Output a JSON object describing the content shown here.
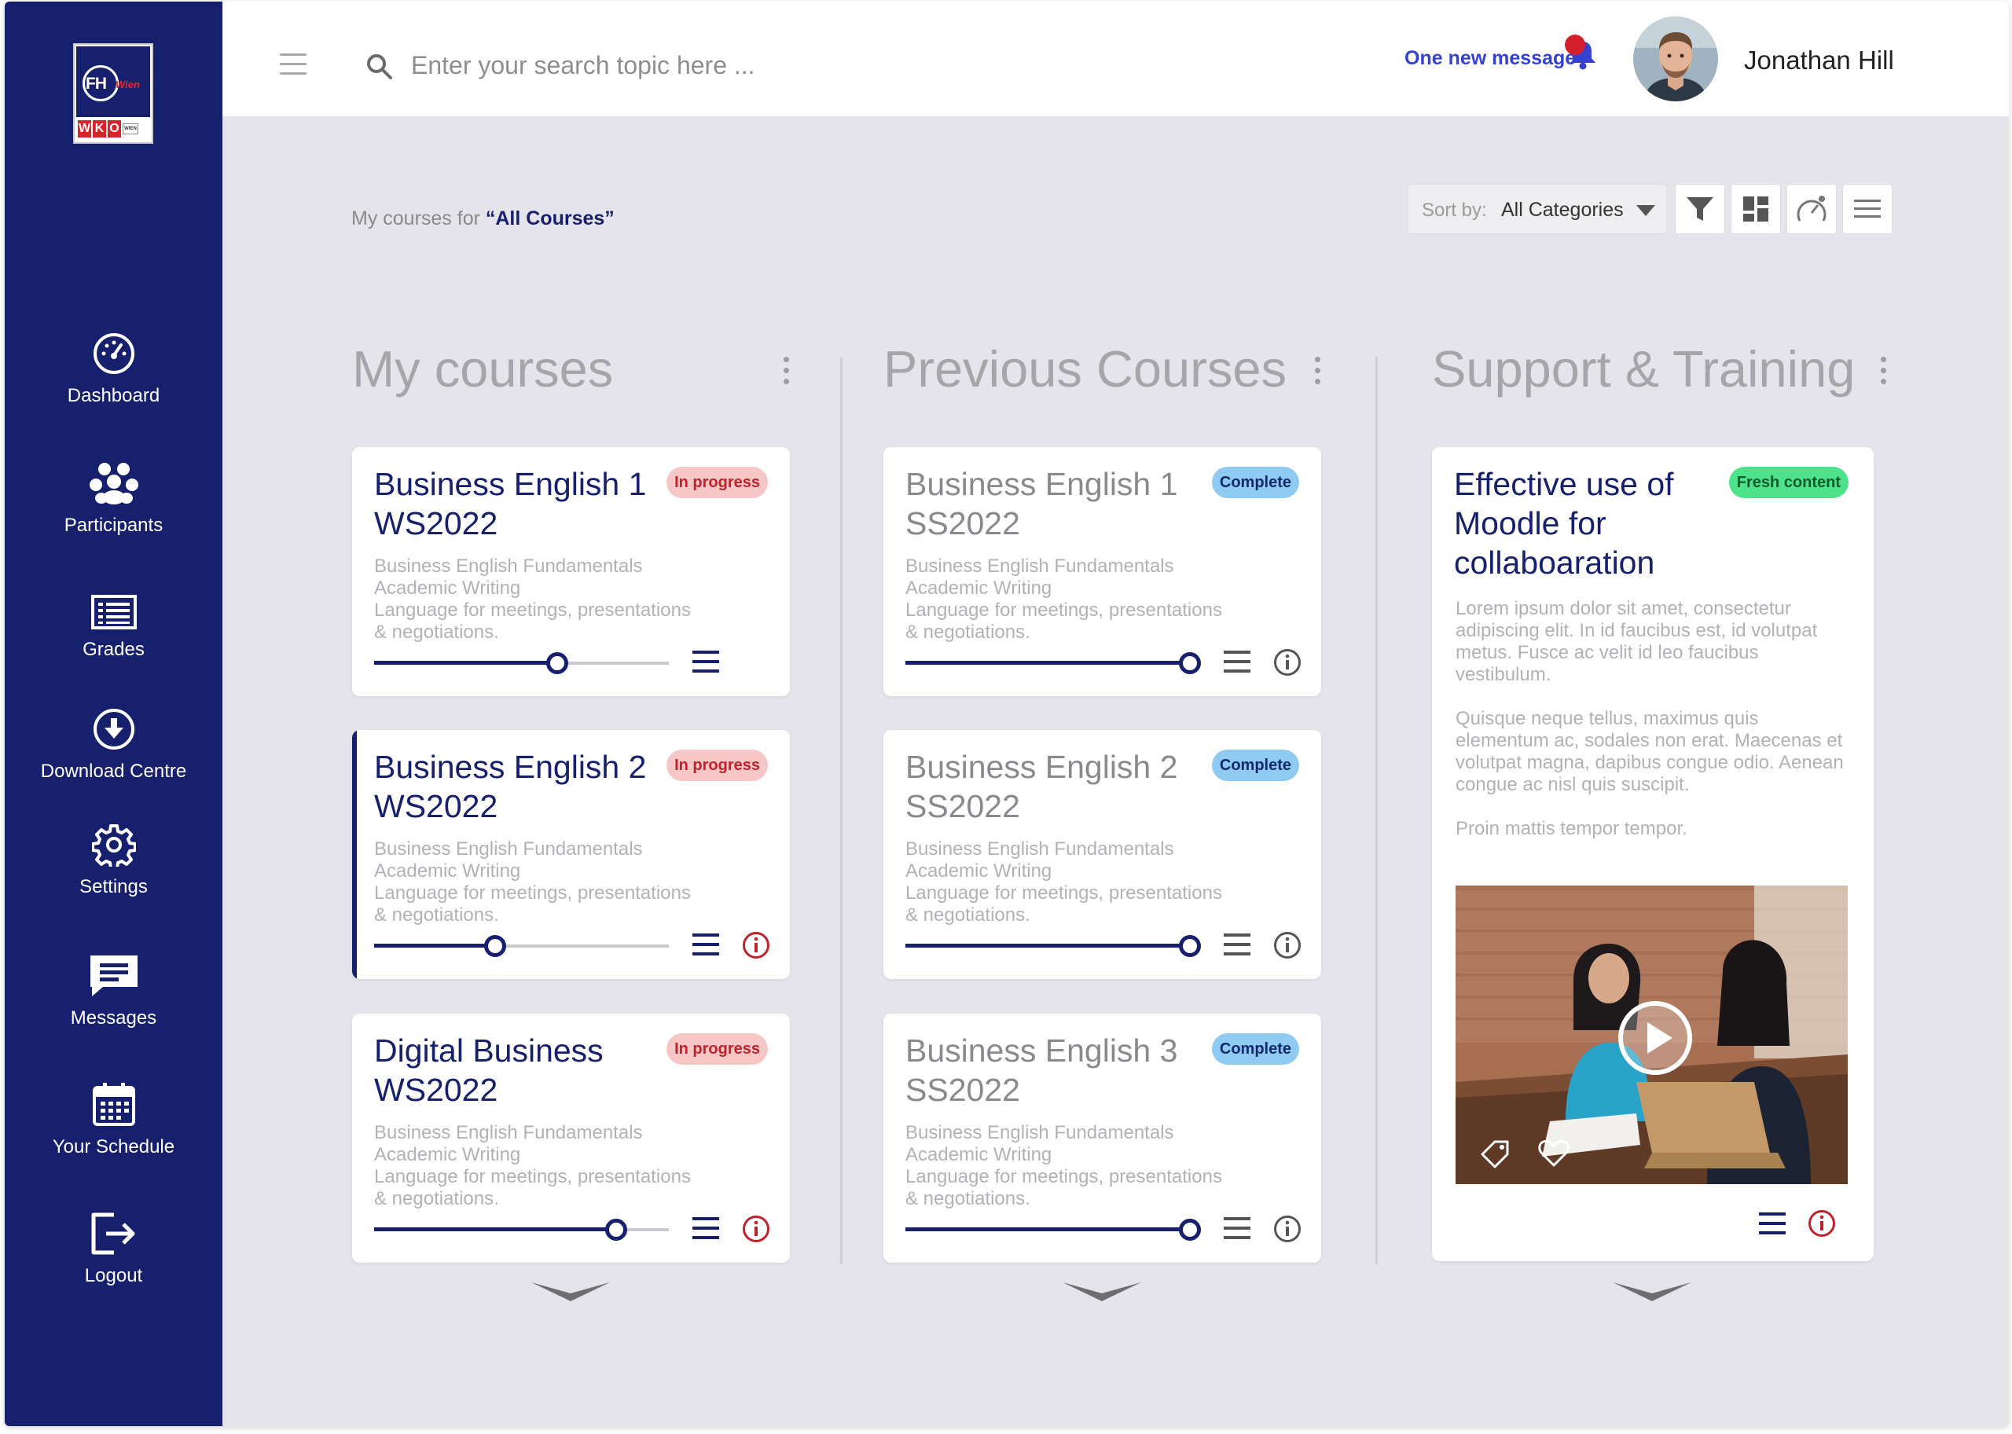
{
  "app": {
    "logo": {
      "fh": "FH",
      "wien": "Wien",
      "wko": [
        "W",
        "K",
        "O"
      ],
      "wko_small": "WIEN"
    }
  },
  "sidebar": {
    "items": [
      {
        "label": "Dashboard",
        "icon": "gauge-icon"
      },
      {
        "label": "Participants",
        "icon": "people-icon"
      },
      {
        "label": "Grades",
        "icon": "grades-icon"
      },
      {
        "label": "Download Centre",
        "icon": "download-icon"
      },
      {
        "label": "Settings",
        "icon": "gear-icon"
      },
      {
        "label": "Messages",
        "icon": "message-icon"
      },
      {
        "label": "Your Schedule",
        "icon": "calendar-icon"
      },
      {
        "label": "Logout",
        "icon": "logout-icon"
      }
    ]
  },
  "header": {
    "search_placeholder": "Enter your search topic here ...",
    "notification_text": "One new message",
    "user_name": "Jonathan Hill"
  },
  "toolbar": {
    "filter_prefix": "My courses for ",
    "filter_value": "“All Courses”",
    "sort_label": "Sort by:",
    "sort_value": "All Categories"
  },
  "columns": {
    "my_courses": {
      "title": "My courses",
      "cards": [
        {
          "title": "Business English 1 WS2022",
          "badge": "In progress",
          "desc": "Business English Fundamentals\nAcademic Writing\nLanguage for meetings, presentations\n& negotiations.",
          "progress": 0.62
        },
        {
          "title": "Business English 2 WS2022",
          "badge": "In progress",
          "desc": "Business English Fundamentals\nAcademic Writing\nLanguage for meetings, presentations\n& negotiations.",
          "progress": 0.41
        },
        {
          "title": "Digital Business WS2022",
          "badge": "In progress",
          "desc": "Business English Fundamentals\nAcademic Writing\nLanguage for meetings, presentations\n& negotiations.",
          "progress": 0.82
        }
      ]
    },
    "previous_courses": {
      "title": "Previous Courses",
      "cards": [
        {
          "title": "Business English 1 SS2022",
          "badge": "Complete",
          "desc": "Business English Fundamentals\nAcademic Writing\nLanguage for meetings, presentations\n& negotiations.",
          "progress": 1.0
        },
        {
          "title": "Business English 2 SS2022",
          "badge": "Complete",
          "desc": "Business English Fundamentals\nAcademic Writing\nLanguage for meetings, presentations\n& negotiations.",
          "progress": 1.0
        },
        {
          "title": "Business English 3 SS2022",
          "badge": "Complete",
          "desc": "Business English Fundamentals\nAcademic Writing\nLanguage for meetings, presentations\n& negotiations.",
          "progress": 1.0
        }
      ]
    },
    "support": {
      "title": "Support & Training",
      "card": {
        "title": "Effective use of Moodle for collaboaration",
        "badge": "Fresh content",
        "paragraphs": [
          "Lorem ipsum dolor sit amet, consectetur adipiscing elit. In id faucibus est, id volutpat metus. Fusce ac velit id leo faucibus vestibulum.",
          "Quisque neque tellus, maximus quis elementum ac, sodales non erat. Maecenas et volutpat magna, dapibus congue odio. Aenean congue ac nisl quis suscipit.",
          "Proin mattis tempor tempor."
        ]
      }
    }
  },
  "colors": {
    "sidebar": "#17206d",
    "accent": "#17206d",
    "link": "#3542d0",
    "in_progress_bg": "#f7c6c6",
    "complete_bg": "#8fcaf0",
    "fresh_bg": "#4ee38a",
    "info_icon": "#c0222c"
  }
}
